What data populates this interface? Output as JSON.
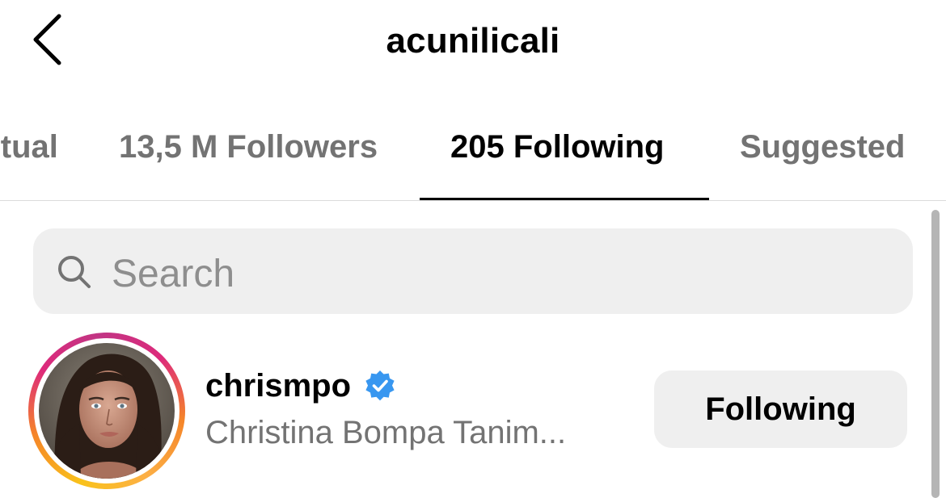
{
  "header": {
    "title": "acunilicali"
  },
  "tabs": [
    {
      "label": "Mutual"
    },
    {
      "label": "13,5 M Followers"
    },
    {
      "label": "205 Following",
      "active": true
    },
    {
      "label": "Suggested"
    }
  ],
  "search": {
    "placeholder": "Search"
  },
  "list": [
    {
      "username": "chrismpo",
      "full_name": "Christina Bompa Tanim...",
      "verified": true,
      "button_label": "Following"
    }
  ],
  "icons": {
    "back": "chevron-left-icon",
    "search": "search-icon",
    "verified": "verified-badge-icon"
  },
  "colors": {
    "verified": "#3897f0",
    "secondary_text": "#737373",
    "surface": "#efefef"
  }
}
